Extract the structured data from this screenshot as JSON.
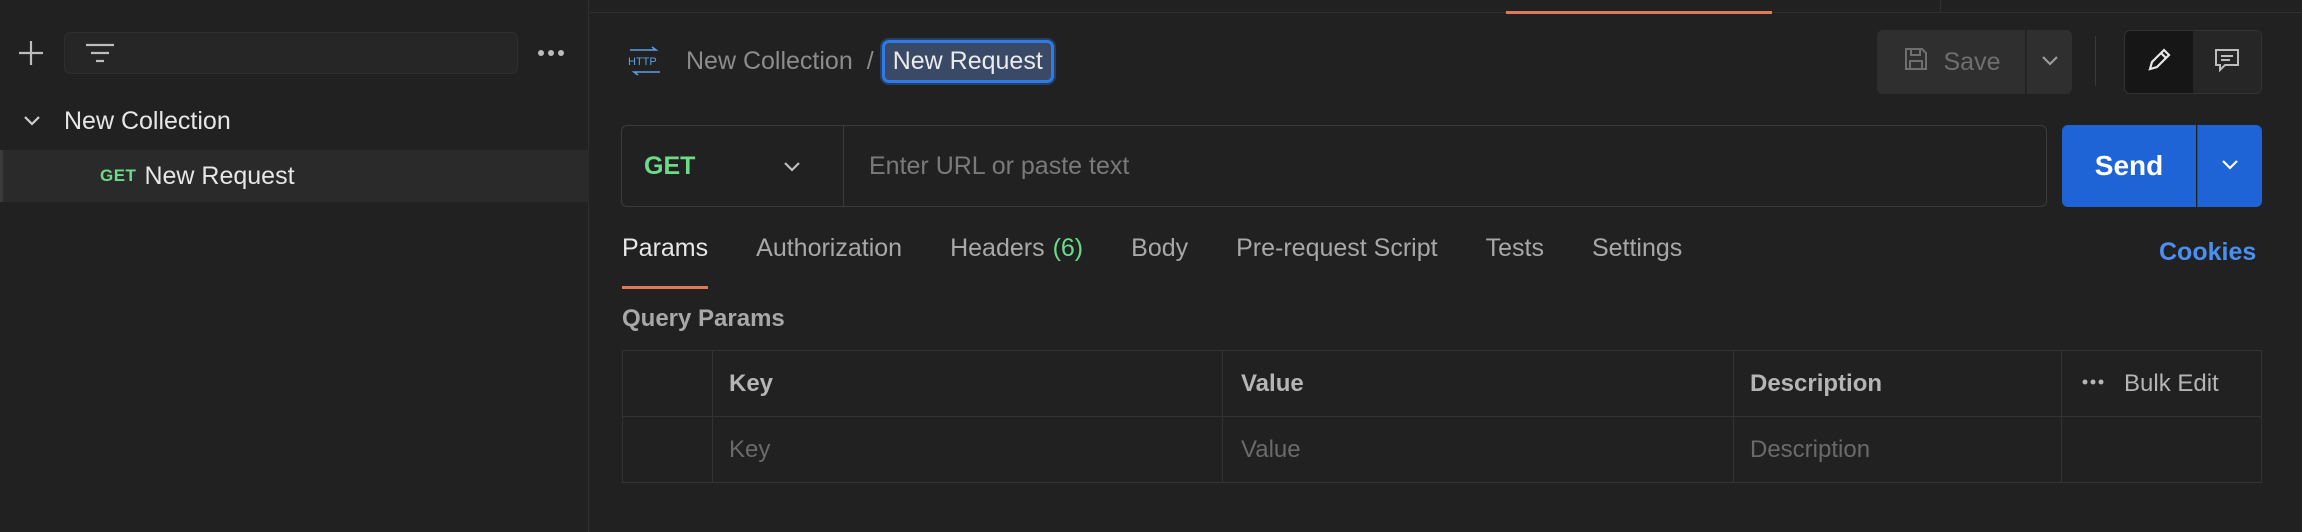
{
  "sidebar": {
    "toolbar": {
      "add_icon": "plus-icon",
      "filter_icon": "filter-icon",
      "more_icon": "more-horizontal-icon"
    },
    "collection": {
      "label": "New Collection",
      "expanded": true
    },
    "request": {
      "method": "GET",
      "label": "New Request"
    }
  },
  "header": {
    "http_icon_label": "HTTP",
    "breadcrumb_collection": "New Collection",
    "breadcrumb_separator": "/",
    "breadcrumb_request": "New Request",
    "save_label": "Save"
  },
  "url_bar": {
    "method": "GET",
    "placeholder": "Enter URL or paste text",
    "send_label": "Send"
  },
  "tabs": {
    "items": [
      {
        "label": "Params",
        "active": true
      },
      {
        "label": "Authorization"
      },
      {
        "label": "Headers",
        "count": "(6)"
      },
      {
        "label": "Body"
      },
      {
        "label": "Pre-request Script"
      },
      {
        "label": "Tests"
      },
      {
        "label": "Settings"
      }
    ],
    "cookies_label": "Cookies"
  },
  "params": {
    "title": "Query Params",
    "columns": [
      "Key",
      "Value",
      "Description"
    ],
    "bulk_edit_label": "Bulk Edit",
    "placeholders": {
      "key": "Key",
      "value": "Value",
      "description": "Description"
    }
  },
  "colors": {
    "background": "#212121",
    "accent_blue": "#1f64d6",
    "method_green": "#6bdb8a",
    "active_tab_orange": "#e0795a",
    "link_blue": "#4a8ff2"
  }
}
